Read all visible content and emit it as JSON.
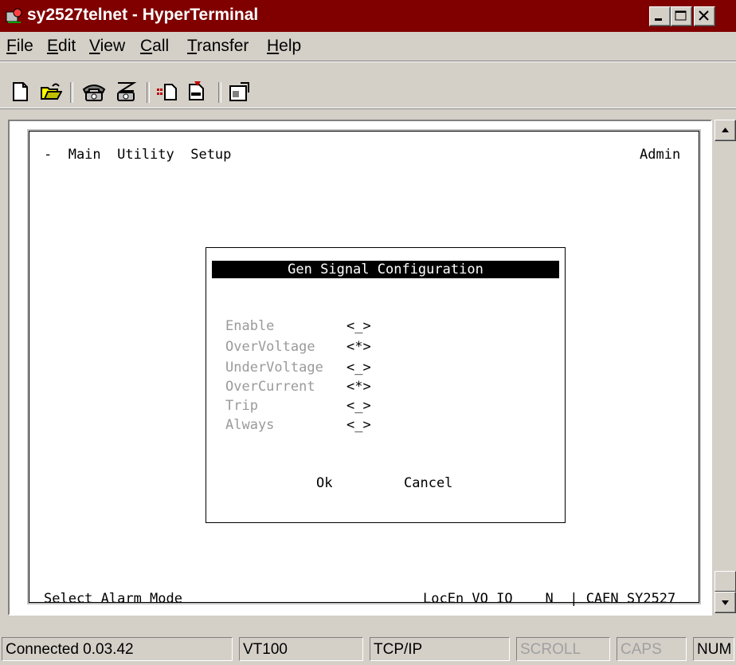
{
  "window": {
    "title": "sy2527telnet - HyperTerminal"
  },
  "menu": [
    {
      "pre": "",
      "ul": "F",
      "post": "ile"
    },
    {
      "pre": "",
      "ul": "E",
      "post": "dit"
    },
    {
      "pre": "",
      "ul": "V",
      "post": "iew"
    },
    {
      "pre": "",
      "ul": "C",
      "post": "all"
    },
    {
      "pre": "",
      "ul": "T",
      "post": "ransfer"
    },
    {
      "pre": "",
      "ul": "H",
      "post": "elp"
    }
  ],
  "toolbar_icons": [
    "new-file-icon",
    "open-folder-icon",
    "call-phone-icon",
    "disconnect-phone-icon",
    "send-icon",
    "receive-icon",
    "properties-icon"
  ],
  "terminal": {
    "top_menu": "-  Main  Utility  Setup",
    "user": "Admin",
    "dialog": {
      "title": "Gen Signal Configuration",
      "options": [
        {
          "label": "Enable",
          "value": "<_>"
        },
        {
          "label": "OverVoltage",
          "value": "<*>"
        },
        {
          "label": "UnderVoltage",
          "value": "<_>"
        },
        {
          "label": "OverCurrent",
          "value": "<*>"
        },
        {
          "label": "Trip",
          "value": "<_>"
        },
        {
          "label": "Always",
          "value": "<_>"
        }
      ],
      "ok": "Ok",
      "cancel": "Cancel"
    },
    "status_left": "Select Alarm Mode",
    "status_right": "LocEn VO IO    N  | CAEN SY2527"
  },
  "statusbar": {
    "connected": "Connected 0.03.42",
    "emulation": "VT100",
    "protocol": "TCP/IP",
    "scroll": "SCROLL",
    "caps": "CAPS",
    "num": "NUM"
  }
}
